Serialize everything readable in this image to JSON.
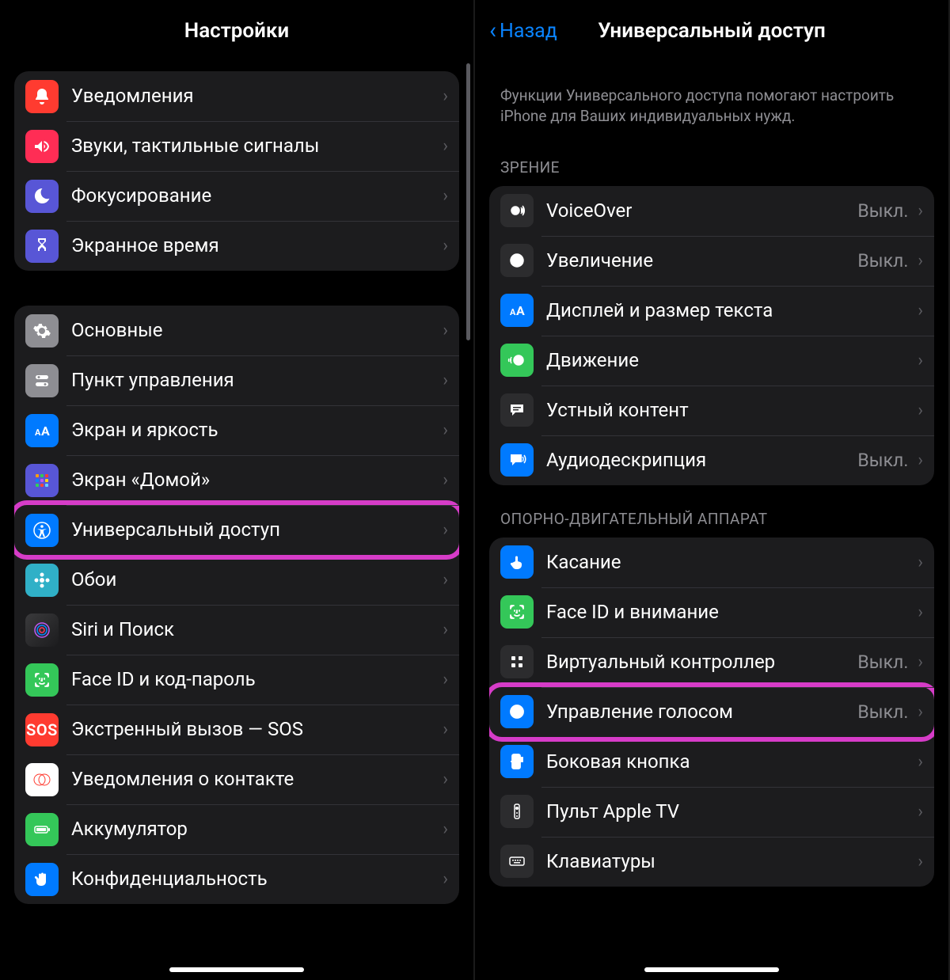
{
  "value_off": "Выкл.",
  "left": {
    "title": "Настройки",
    "items": [
      {
        "id": "notifications",
        "label": "Уведомления"
      },
      {
        "id": "sounds",
        "label": "Звуки, тактильные сигналы"
      },
      {
        "id": "focus",
        "label": "Фокусирование"
      },
      {
        "id": "screentime",
        "label": "Экранное время"
      }
    ],
    "items2": [
      {
        "id": "general",
        "label": "Основные"
      },
      {
        "id": "control-center",
        "label": "Пункт управления"
      },
      {
        "id": "display",
        "label": "Экран и яркость"
      },
      {
        "id": "home",
        "label": "Экран «Домой»"
      },
      {
        "id": "accessibility",
        "label": "Универсальный доступ",
        "highlight": true
      },
      {
        "id": "wallpaper",
        "label": "Обои"
      },
      {
        "id": "siri",
        "label": "Siri и Поиск"
      },
      {
        "id": "faceid",
        "label": "Face ID и код-пароль"
      },
      {
        "id": "sos",
        "label": "Экстренный вызов — SOS"
      },
      {
        "id": "exposure",
        "label": "Уведомления о контакте"
      },
      {
        "id": "battery",
        "label": "Аккумулятор"
      },
      {
        "id": "privacy",
        "label": "Конфиденциальность"
      }
    ]
  },
  "right": {
    "back": "Назад",
    "title": "Универсальный доступ",
    "description": "Функции Универсального доступа помогают настроить iPhone для Ваших индивидуальных нужд.",
    "section_vision": "ЗРЕНИЕ",
    "vision": [
      {
        "id": "voiceover",
        "label": "VoiceOver",
        "value": "Выкл."
      },
      {
        "id": "zoom",
        "label": "Увеличение",
        "value": "Выкл."
      },
      {
        "id": "display-text",
        "label": "Дисплей и размер текста"
      },
      {
        "id": "motion",
        "label": "Движение"
      },
      {
        "id": "spoken",
        "label": "Устный контент"
      },
      {
        "id": "audiodesc",
        "label": "Аудиодескрипция",
        "value": "Выкл."
      }
    ],
    "section_motor": "ОПОРНО-ДВИГАТЕЛЬНЫЙ АППАРАТ",
    "motor": [
      {
        "id": "touch",
        "label": "Касание"
      },
      {
        "id": "faceid-attn",
        "label": "Face ID и внимание"
      },
      {
        "id": "switch-control",
        "label": "Виртуальный контроллер",
        "value": "Выкл."
      },
      {
        "id": "voice-control",
        "label": "Управление голосом",
        "value": "Выкл.",
        "highlight": true
      },
      {
        "id": "side-button",
        "label": "Боковая кнопка"
      },
      {
        "id": "apple-tv-remote",
        "label": "Пульт Apple TV"
      },
      {
        "id": "keyboards",
        "label": "Клавиатуры"
      }
    ]
  }
}
